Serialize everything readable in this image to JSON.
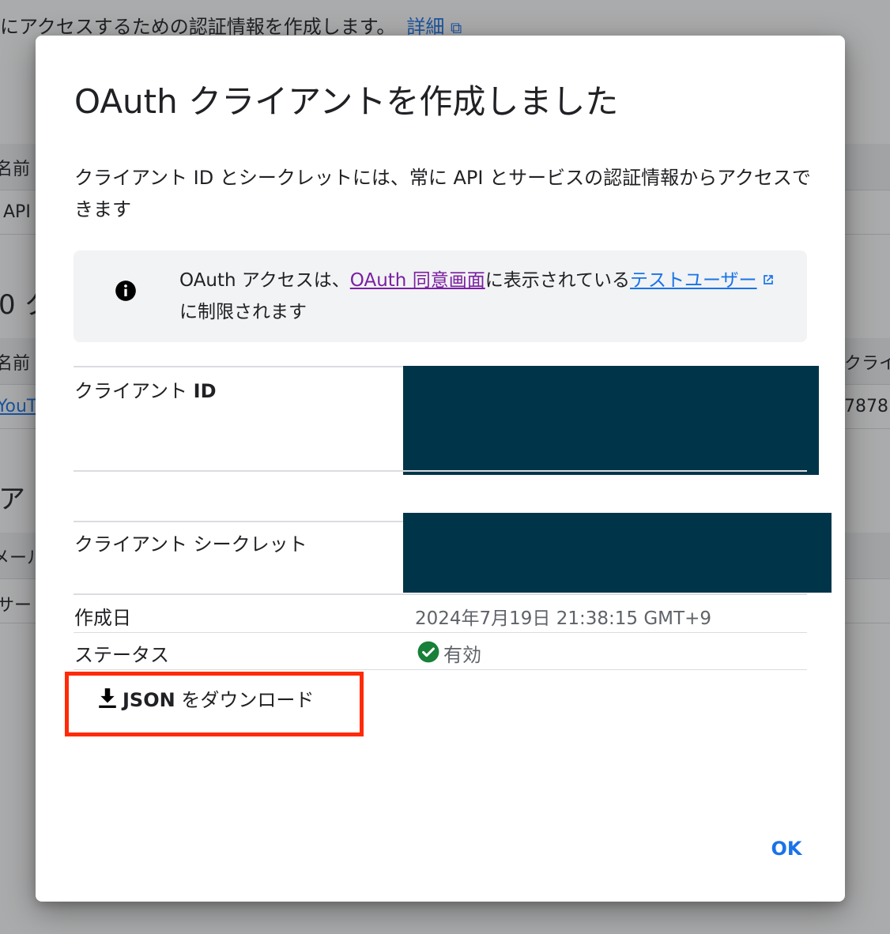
{
  "background": {
    "intro_text": "にアクセスするための認証情報を作成します。",
    "intro_link": "詳細",
    "table1_header_name": "名前",
    "table1_row1": "API",
    "section2_heading_fragment": "0 ク",
    "table2_header_name": "名前",
    "table2_header_client": "クライ",
    "table2_row1_name": "YouT",
    "table2_row1_client": "7878",
    "section3_heading_fragment": "ア",
    "table3_header": "メール",
    "table3_row1": "サー"
  },
  "dialog": {
    "title": "OAuth クライアントを作成しました",
    "description": "クライアント ID とシークレットには、常に API とサービスの認証情報からアクセスできます",
    "notice": {
      "icon": "info-icon",
      "text_prefix": "OAuth アクセスは、",
      "link1": "OAuth 同意画面",
      "text_middle": "に表示されている",
      "link2": "テストユーザー",
      "text_suffix": "に制限されます"
    },
    "fields": {
      "client_id_label_prefix": "クライアント ",
      "client_id_label_bold": "ID",
      "client_secret_label": "クライアント シークレット",
      "created_label": "作成日",
      "created_value": "2024年7月19日 21:38:15 GMT+9",
      "status_label": "ステータス",
      "status_value": "有効"
    },
    "download_button": {
      "bold": "JSON",
      "rest": " をダウンロード",
      "icon": "download-icon"
    },
    "ok_button": "OK"
  },
  "colors": {
    "link_blue": "#1a73e8",
    "visited_purple": "#7b1fa2",
    "redaction": "#003549",
    "highlight_red": "#ff2a06",
    "status_green": "#188038"
  }
}
